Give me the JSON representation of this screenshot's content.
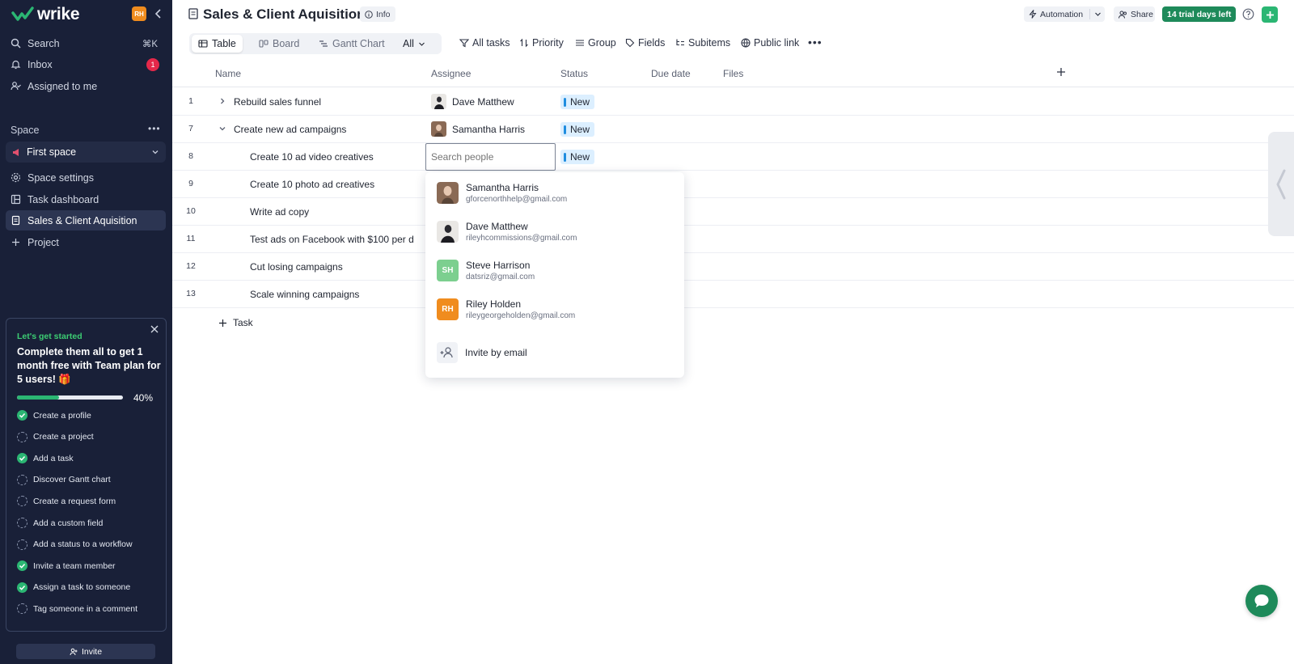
{
  "app": {
    "logo_text": "wrike",
    "user_initials": "RH"
  },
  "sidebar": {
    "nav": [
      {
        "label": "Search",
        "shortcut": "⌘K"
      },
      {
        "label": "Inbox",
        "badge": "1"
      },
      {
        "label": "Assigned to me"
      }
    ],
    "space_label": "Space",
    "space_more": "•••",
    "space_select": "First space",
    "space_items": [
      {
        "label": "Space settings"
      },
      {
        "label": "Task dashboard"
      },
      {
        "label": "Sales & Client Aquisition"
      },
      {
        "label": "Project"
      }
    ],
    "getting_started": {
      "kicker": "Let's get started",
      "title": "Complete them all to get 1 month free with Team plan for 5 users! 🎁",
      "progress": 0.4,
      "progress_label": "40%",
      "items": [
        {
          "label": "Create a profile",
          "done": true
        },
        {
          "label": "Create a project",
          "done": false
        },
        {
          "label": "Add a task",
          "done": true
        },
        {
          "label": "Discover Gantt chart",
          "done": false
        },
        {
          "label": "Create a request form",
          "done": false
        },
        {
          "label": "Add a custom field",
          "done": false
        },
        {
          "label": "Add a status to a workflow",
          "done": false
        },
        {
          "label": "Invite a team member",
          "done": true
        },
        {
          "label": "Assign a task to someone",
          "done": true
        },
        {
          "label": "Tag someone in a comment",
          "done": false
        }
      ]
    },
    "invite_label": "Invite"
  },
  "header": {
    "title": "Sales & Client Aquisition",
    "info_label": "Info",
    "automation_label": "Automation",
    "share_label": "Share",
    "trial_label": "14 trial days left"
  },
  "views": {
    "tabs": [
      "Table",
      "Board",
      "Gantt Chart"
    ],
    "all_label": "All"
  },
  "toolbar": {
    "items": [
      "All tasks",
      "Priority",
      "Group",
      "Fields",
      "Subitems",
      "Public link"
    ]
  },
  "table": {
    "columns": [
      "Name",
      "Assignee",
      "Status",
      "Due date",
      "Files"
    ],
    "rows": [
      {
        "num": "1",
        "name": "Rebuild sales funnel",
        "assignee": "Dave Matthew",
        "status": "New"
      },
      {
        "num": "7",
        "name": "Create new ad campaigns",
        "assignee": "Samantha Harris",
        "status": "New"
      },
      {
        "num": "8",
        "name": "Create 10 ad video creatives",
        "assignee": "",
        "status": "New"
      },
      {
        "num": "9",
        "name": "Create 10 photo ad creatives"
      },
      {
        "num": "10",
        "name": "Write ad copy"
      },
      {
        "num": "11",
        "name": "Test ads on Facebook with $100 per d"
      },
      {
        "num": "12",
        "name": "Cut losing campaigns"
      },
      {
        "num": "13",
        "name": "Scale winning campaigns"
      }
    ],
    "add_task_label": "Task"
  },
  "people_picker": {
    "placeholder": "Search people",
    "people": [
      {
        "name": "Samantha Harris",
        "email": "gforcenorthhelp@gmail.com",
        "initials": "",
        "color": "#8a6a55"
      },
      {
        "name": "Dave Matthew",
        "email": "rileyhcommissions@gmail.com",
        "initials": "",
        "color": "#2a2a30"
      },
      {
        "name": "Steve Harrison",
        "email": "datsriz@gmail.com",
        "initials": "SH",
        "color": "#7ccf8f"
      },
      {
        "name": "Riley Holden",
        "email": "rileygeorgeholden@gmail.com",
        "initials": "RH",
        "color": "#f08c1e"
      }
    ],
    "invite_label": "Invite by email"
  }
}
